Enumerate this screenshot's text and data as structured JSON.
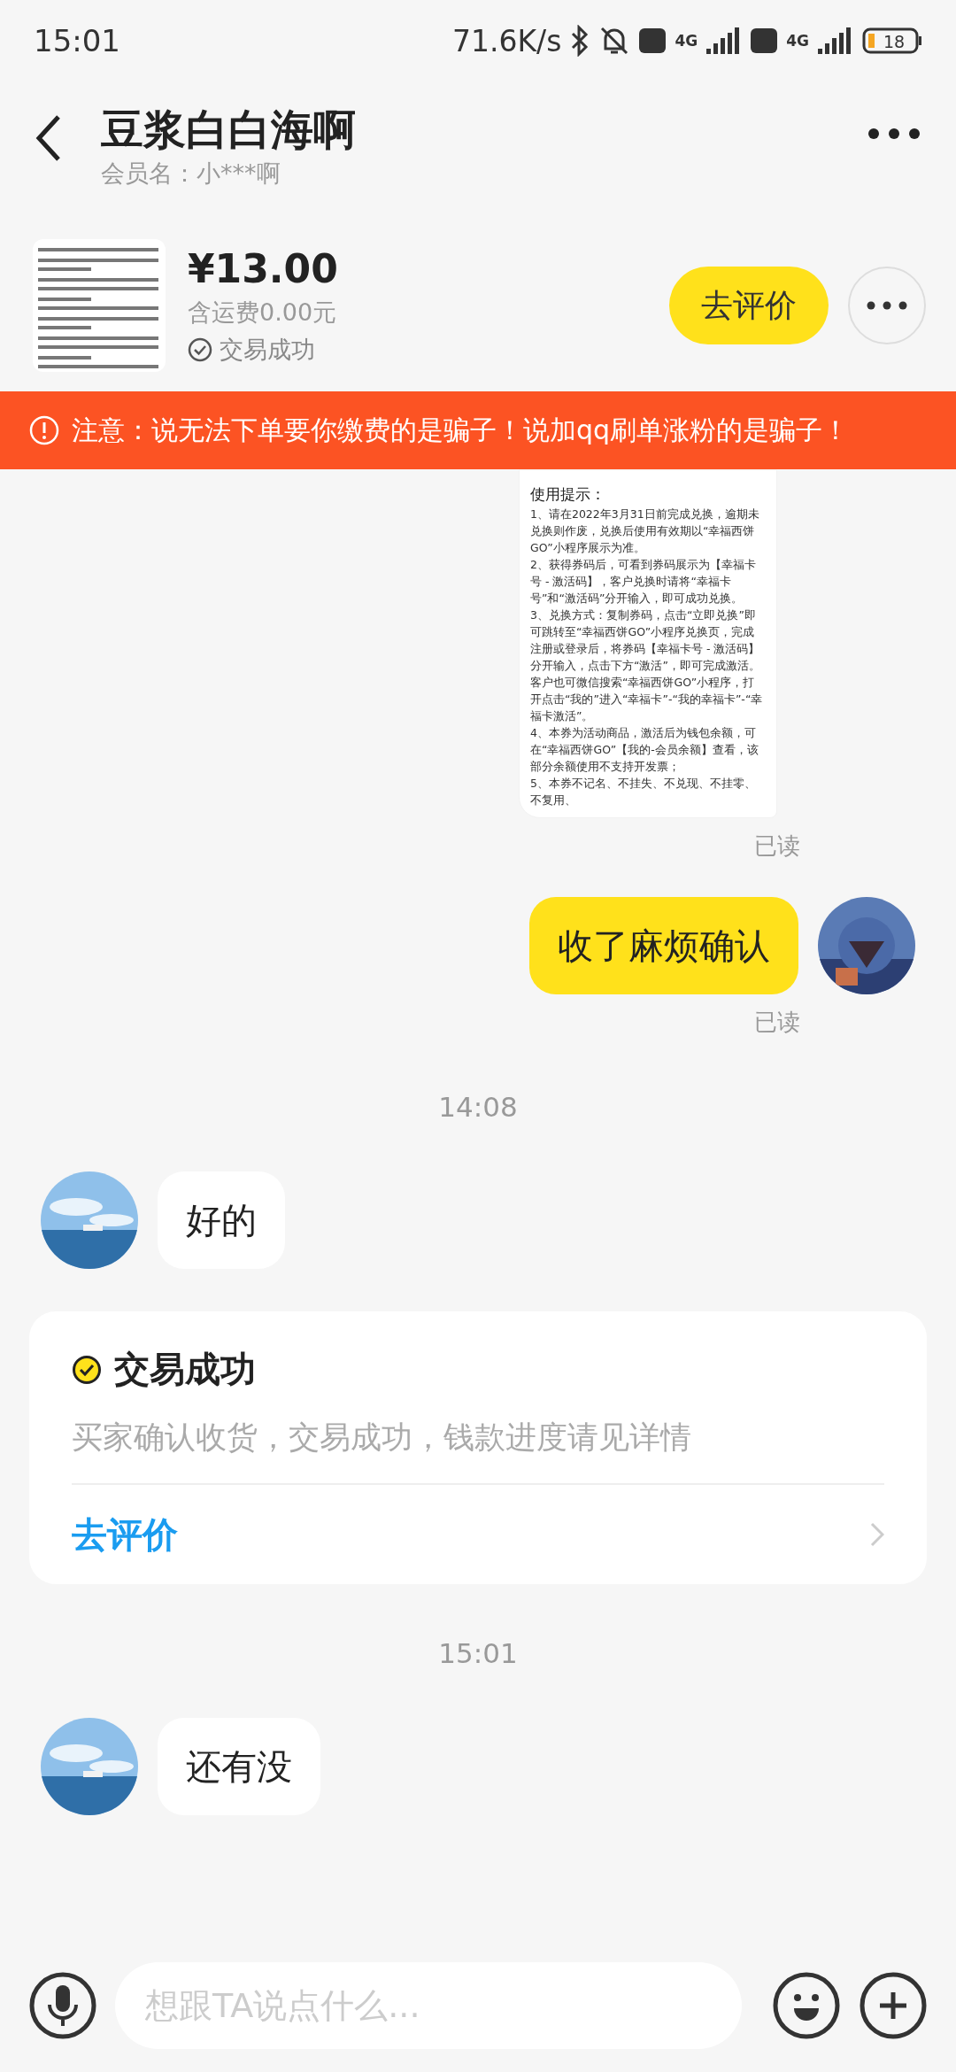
{
  "status_bar": {
    "time": "15:01",
    "net_speed": "71.6K/s",
    "sim_label": "4G",
    "sim2_label": "4G",
    "battery": "18"
  },
  "header": {
    "title": "豆浆白白海啊",
    "member_name": "会员名：小***啊"
  },
  "product": {
    "price": "¥13.00",
    "shipping": "含运费0.00元",
    "status": "交易成功",
    "review_button": "去评价"
  },
  "warning": {
    "text": "注意：说无法下单要你缴费的是骗子！说加qq刷单涨粉的是骗子！"
  },
  "messages": [
    {
      "outgoing": true,
      "doc_title": "使用提示：",
      "doc_lines": [
        "1、请在2022年3月31日前完成兑换，逾期未兑换则作废，兑换后使用有效期以“幸福西饼GO”小程序展示为准。",
        "2、获得券码后，可看到券码展示为【幸福卡号 - 激活码】，客户兑换时请将“幸福卡号”和“激活码”分开输入，即可成功兑换。",
        "3、兑换方式：复制券码，点击“立即兑换”即可跳转至“幸福西饼GO”小程序兑换页，完成注册或登录后，将券码【幸福卡号 - 激活码】分开输入，点击下方“激活”，即可完成激活。客户也可微信搜索“幸福西饼GO”小程序，打开点击“我的”进入“幸福卡”-“我的幸福卡”-“幸福卡激活”。",
        "4、本券为活动商品，激活后为钱包余额，可在“幸福西饼GO”【我的-会员余额】查看，该部分余额使用不支持开发票；",
        "5、本券不记名、不挂失、不兑现、不挂零、不复用、"
      ],
      "read": "已读"
    },
    {
      "kind": "text",
      "outgoing": true,
      "text": "收了麻烦确认",
      "read": "已读"
    },
    {
      "kind": "time",
      "text": "14:08"
    },
    {
      "kind": "text",
      "outgoing": false,
      "text": "好的"
    },
    {
      "kind": "card",
      "title": "交易成功",
      "body": "买家确认收货，交易成功，钱款进度请见详情",
      "link": "去评价"
    },
    {
      "kind": "time",
      "text": "15:01"
    },
    {
      "kind": "text",
      "outgoing": false,
      "text": "还有没"
    }
  ],
  "input": {
    "placeholder": "想跟TA说点什么..."
  }
}
